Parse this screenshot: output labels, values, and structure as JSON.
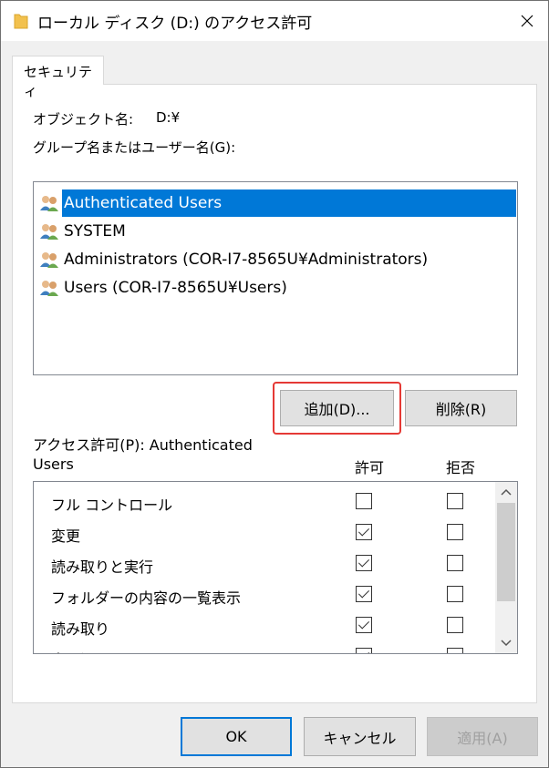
{
  "window": {
    "title": "ローカル ディスク (D:) のアクセス許可"
  },
  "tab": {
    "label": "セキュリティ"
  },
  "object": {
    "label": "オブジェクト名:",
    "value": "D:¥"
  },
  "groups_label": "グループ名またはユーザー名(G):",
  "users": [
    {
      "name": "Authenticated Users",
      "selected": true
    },
    {
      "name": "SYSTEM",
      "selected": false
    },
    {
      "name": "Administrators (COR-I7-8565U¥Administrators)",
      "selected": false
    },
    {
      "name": "Users (COR-I7-8565U¥Users)",
      "selected": false
    }
  ],
  "buttons": {
    "add": "追加(D)...",
    "remove": "削除(R)",
    "ok": "OK",
    "cancel": "キャンセル",
    "apply": "適用(A)"
  },
  "permissions": {
    "label_line1": "アクセス許可(P): Authenticated",
    "label_line2": "Users",
    "col_allow": "許可",
    "col_deny": "拒否",
    "rows": [
      {
        "name": "フル コントロール",
        "allow": false,
        "deny": false
      },
      {
        "name": "変更",
        "allow": true,
        "deny": false
      },
      {
        "name": "読み取りと実行",
        "allow": true,
        "deny": false
      },
      {
        "name": "フォルダーの内容の一覧表示",
        "allow": true,
        "deny": false
      },
      {
        "name": "読み取り",
        "allow": true,
        "deny": false
      },
      {
        "name": "書き込み",
        "allow": true,
        "deny": false
      }
    ]
  },
  "colors": {
    "selection": "#0078d7",
    "highlight": "#e53935"
  }
}
